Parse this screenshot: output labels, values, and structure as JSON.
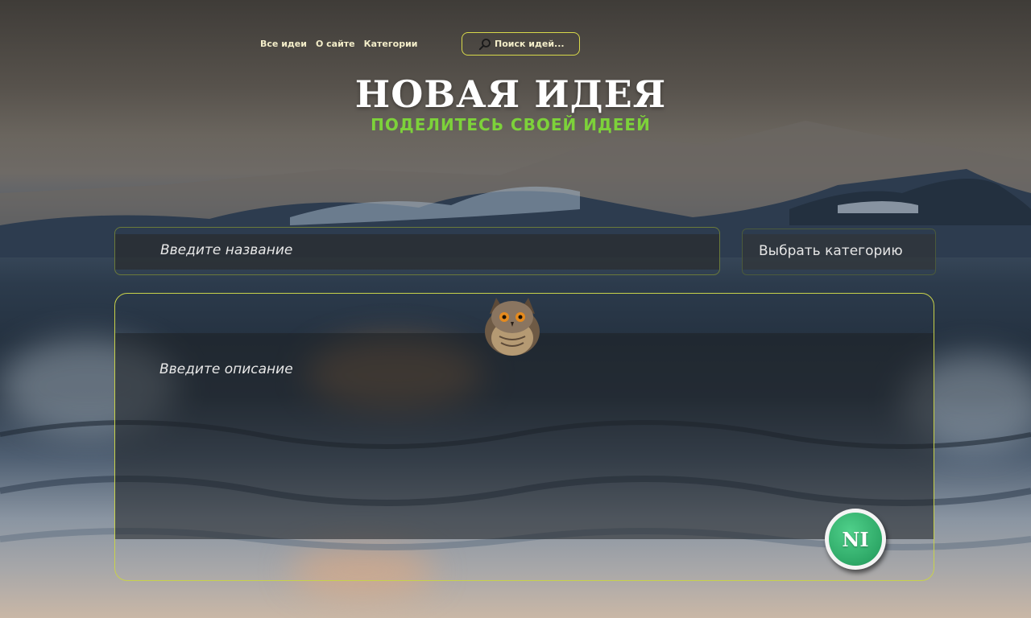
{
  "nav": {
    "items": [
      {
        "label": "Все идеи"
      },
      {
        "label": "О сайте"
      },
      {
        "label": "Категории"
      }
    ]
  },
  "search": {
    "placeholder": "Поиск идей...",
    "icon": "search-icon"
  },
  "header": {
    "title": "НОВАЯ ИДЕЯ",
    "subtitle": "ПОДЕЛИТЕСЬ СВОЕЙ ИДЕЕЙ"
  },
  "form": {
    "name_placeholder": "Введите название",
    "category_label": "Выбрать категорию",
    "description_placeholder": "Введите описание",
    "submit_label": "NI"
  },
  "colors": {
    "accent_green": "#7dd23a",
    "border_yellow": "#d8d94a",
    "submit_green": "#2ea867"
  }
}
